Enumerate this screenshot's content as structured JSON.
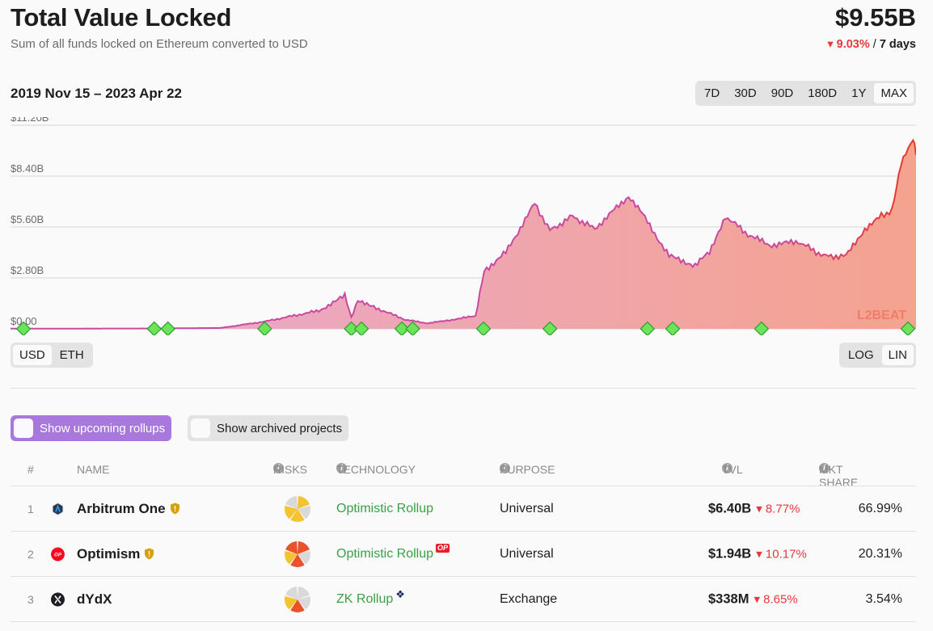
{
  "header": {
    "title": "Total Value Locked",
    "subtitle": "Sum of all funds locked on Ethereum converted to USD",
    "total": "$9.55B",
    "change_pct": "9.03%",
    "change_sep": " / ",
    "change_period": "7 days"
  },
  "chart": {
    "date_range": "2019 Nov 15 – 2023 Apr 22",
    "ranges": [
      "7D",
      "30D",
      "90D",
      "180D",
      "1Y",
      "MAX"
    ],
    "active_range": "MAX",
    "units": [
      "USD",
      "ETH"
    ],
    "active_unit": "USD",
    "scales": [
      "LOG",
      "LIN"
    ],
    "active_scale": "LIN",
    "watermark": "L2BEAT",
    "colors": {
      "line_start": "#c84aa0",
      "line_end": "#e8391d",
      "fill_start": "#e9a8d3",
      "fill_end": "#f4a38f",
      "marker": "#6be35a"
    }
  },
  "chart_data": {
    "type": "area",
    "title": "",
    "xlabel": "",
    "ylabel": "",
    "y_tick_labels": [
      "$0.00",
      "$2.80B",
      "$5.60B",
      "$8.40B",
      "$11.20B"
    ],
    "ylim": [
      0,
      11.2
    ],
    "y_unit": "$B",
    "x_range": [
      "2019-11-15",
      "2023-04-22"
    ],
    "grid": true,
    "series": [
      {
        "values_x": [
          "2019-11-15",
          "2020-06-01",
          "2020-09-01",
          "2020-11-01",
          "2021-01-15",
          "2021-02-20",
          "2021-03-01",
          "2021-03-10",
          "2021-04-01",
          "2021-05-15",
          "2021-06-15",
          "2021-08-20",
          "2021-09-01",
          "2021-10-01",
          "2021-11-10",
          "2021-12-01",
          "2022-01-01",
          "2022-02-01",
          "2022-03-20",
          "2022-04-05",
          "2022-05-15",
          "2022-06-20",
          "2022-07-10",
          "2022-08-01",
          "2022-09-01",
          "2022-10-01",
          "2022-11-10",
          "2022-12-15",
          "2023-01-15",
          "2023-02-10",
          "2023-03-05",
          "2023-03-20",
          "2023-04-01",
          "2023-04-18",
          "2023-04-22"
        ],
        "values_y": [
          0.01,
          0.02,
          0.05,
          0.4,
          1.0,
          1.8,
          0.6,
          1.5,
          1.2,
          0.5,
          0.3,
          0.7,
          3.2,
          4.2,
          6.9,
          5.4,
          6.2,
          5.5,
          7.3,
          6.5,
          4.0,
          3.5,
          4.2,
          6.2,
          5.2,
          4.6,
          4.8,
          4.0,
          4.0,
          5.5,
          6.2,
          6.5,
          9.0,
          10.5,
          9.55
        ]
      }
    ],
    "markers_x": [
      "2019-11-15",
      "2020-06-01",
      "2020-06-20",
      "2020-11-01",
      "2021-03-01",
      "2021-03-15",
      "2021-05-10",
      "2021-05-25",
      "2021-08-31",
      "2021-12-01",
      "2022-04-15",
      "2022-05-20",
      "2022-09-20",
      "2023-04-15"
    ]
  },
  "filters": {
    "upcoming_label": "Show upcoming rollups",
    "archived_label": "Show archived projects"
  },
  "table": {
    "headers": {
      "index": "#",
      "name": "NAME",
      "risks": "RISKS",
      "technology": "TECHNOLOGY",
      "purpose": "PURPOSE",
      "tvl": "TVL",
      "share": "MKT SHARE"
    },
    "rows": [
      {
        "index": "1",
        "name": "Arbitrum One",
        "technology": "Optimistic Rollup",
        "tech_badge": "",
        "purpose": "Universal",
        "tvl": "$6.40B",
        "tvl_change": "8.77%",
        "share": "66.99%",
        "logo_color": "#2d374b",
        "risk_colors": [
          "#f4c430",
          "#d9d9d9",
          "#f4c430",
          "#f4c430",
          "#d9d9d9"
        ]
      },
      {
        "index": "2",
        "name": "Optimism",
        "technology": "Optimistic Rollup",
        "tech_badge": "OP",
        "purpose": "Universal",
        "tvl": "$1.94B",
        "tvl_change": "10.17%",
        "share": "20.31%",
        "logo_color": "#ff0420",
        "risk_colors": [
          "#e9532b",
          "#d9d9d9",
          "#e9532b",
          "#f4c430",
          "#e9532b"
        ]
      },
      {
        "index": "3",
        "name": "dYdX",
        "technology": "ZK Rollup",
        "tech_badge": "star",
        "purpose": "Exchange",
        "tvl": "$338M",
        "tvl_change": "8.65%",
        "share": "3.54%",
        "logo_color": "#1e1e24",
        "risk_colors": [
          "#d9d9d9",
          "#d9d9d9",
          "#e9532b",
          "#f4c430",
          "#d9d9d9"
        ]
      }
    ]
  }
}
